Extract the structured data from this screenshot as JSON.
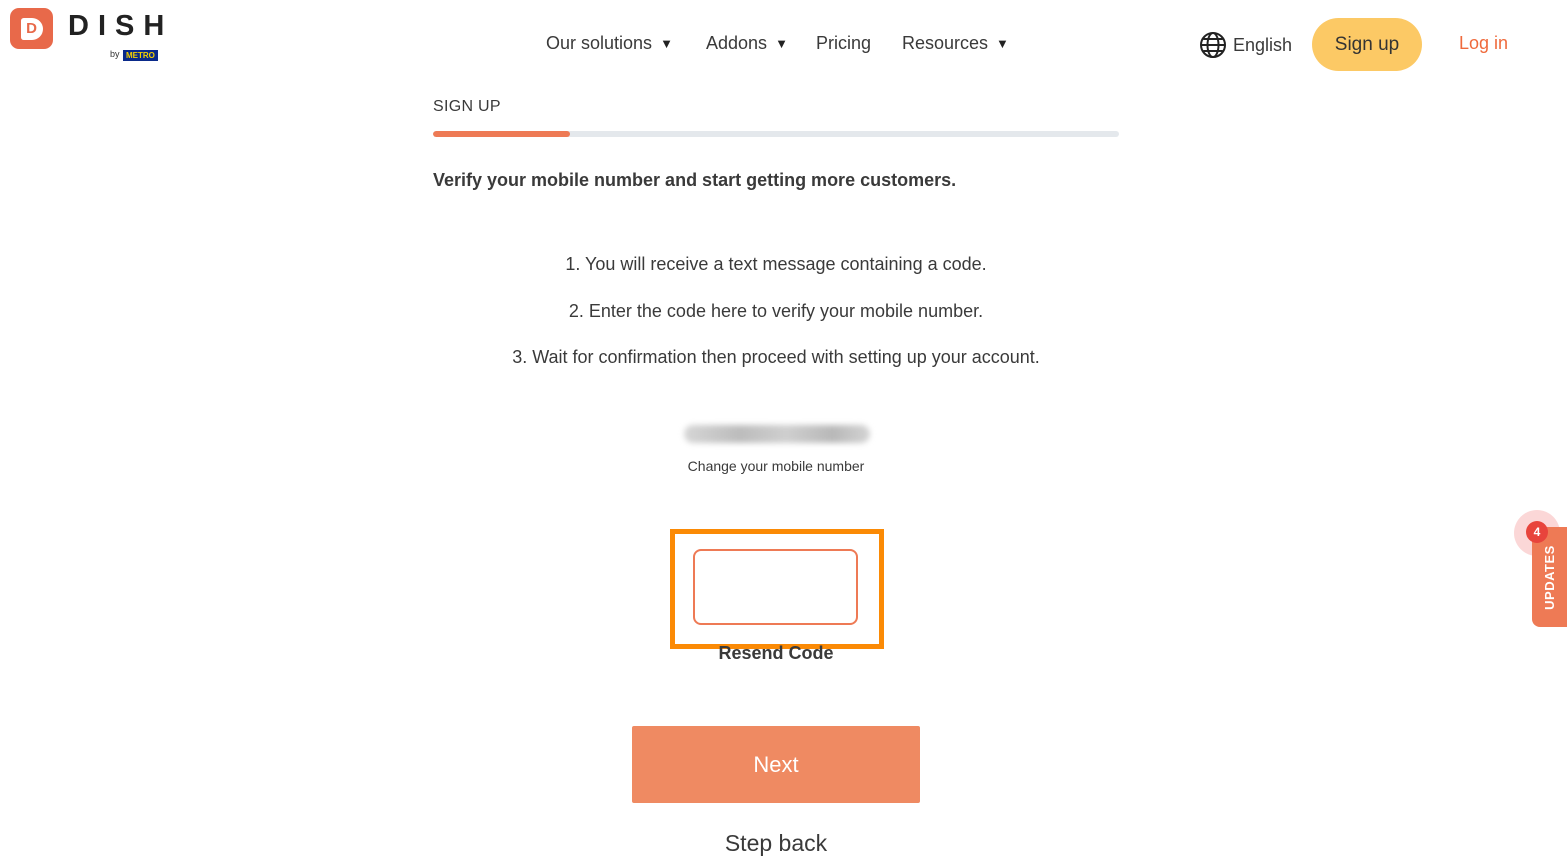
{
  "brand": {
    "name": "DISH",
    "by": "by",
    "partner": "METRO"
  },
  "nav": {
    "items": [
      {
        "label": "Our solutions",
        "dropdown": true
      },
      {
        "label": "Addons",
        "dropdown": true
      },
      {
        "label": "Pricing",
        "dropdown": false
      },
      {
        "label": "Resources",
        "dropdown": true
      }
    ],
    "language": "English",
    "signup_label": "Sign up",
    "login_label": "Log in"
  },
  "signup": {
    "section_title": "SIGN UP",
    "progress_fraction": 0.2,
    "headline": "Verify your mobile number and start getting more customers.",
    "steps": [
      "1. You will receive a text message containing a code.",
      "2. Enter the code here to verify your mobile number.",
      "3. Wait for confirmation then proceed with setting up your account."
    ],
    "change_number_label": "Change your mobile number",
    "code_value": "",
    "resend_label": "Resend Code",
    "next_label": "Next",
    "step_back_label": "Step back"
  },
  "updates": {
    "label": "UPDATES",
    "count": "4"
  },
  "colors": {
    "accent": "#ee7a55",
    "signup_button": "#fcc965",
    "highlight": "#fb8a05",
    "login_link": "#ef6a3c"
  },
  "icons": {
    "language": "globe-icon",
    "dropdown": "caret-down-icon"
  }
}
